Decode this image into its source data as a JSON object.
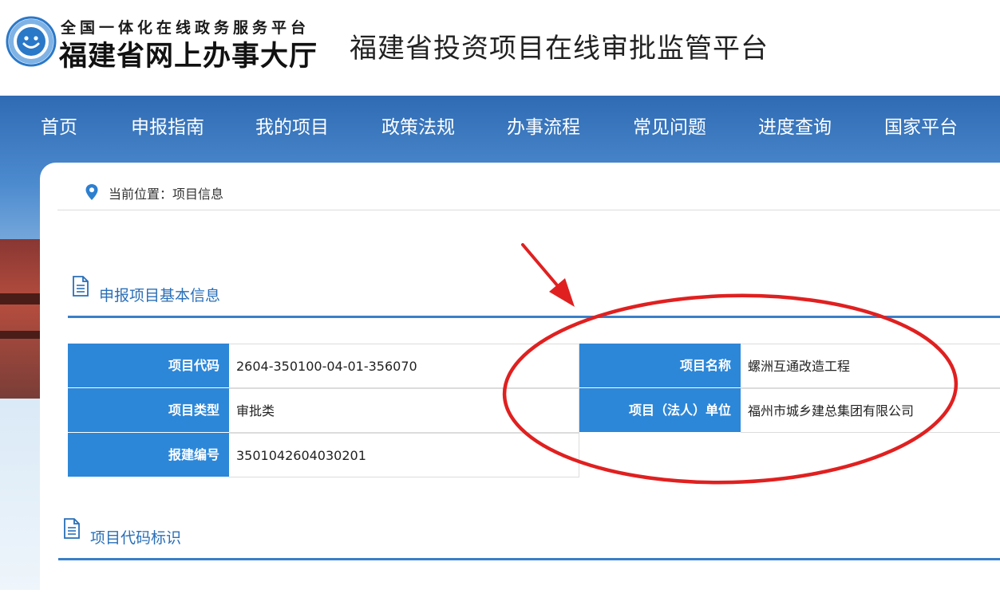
{
  "header": {
    "logo_subtitle": "全国一体化在线政务服务平台",
    "logo_title": "福建省网上办事大厅",
    "platform_title": "福建省投资项目在线审批监管平台"
  },
  "nav": {
    "items": [
      {
        "label": "首页"
      },
      {
        "label": "申报指南"
      },
      {
        "label": "我的项目"
      },
      {
        "label": "政策法规"
      },
      {
        "label": "办事流程"
      },
      {
        "label": "常见问题"
      },
      {
        "label": "进度查询"
      },
      {
        "label": "国家平台"
      }
    ]
  },
  "breadcrumb": {
    "text": "当前位置：项目信息"
  },
  "sections": {
    "basic_info_title": "申报项目基本信息",
    "code_id_title": "项目代码标识"
  },
  "basic_info": {
    "project_code_label": "项目代码",
    "project_code_value": "2604-350100-04-01-356070",
    "project_name_label": "项目名称",
    "project_name_value": "螺洲互通改造工程",
    "project_type_label": "项目类型",
    "project_type_value": "审批类",
    "legal_unit_label": "项目（法人）单位",
    "legal_unit_value": "福州市城乡建总集团有限公司",
    "filing_no_label": "报建编号",
    "filing_no_value": "3501042604030201"
  },
  "colors": {
    "nav_bg": "#2f6bb3",
    "label_bg": "#2d87d8",
    "section_title": "#2a6fb7",
    "annotation_red": "#e02020"
  }
}
